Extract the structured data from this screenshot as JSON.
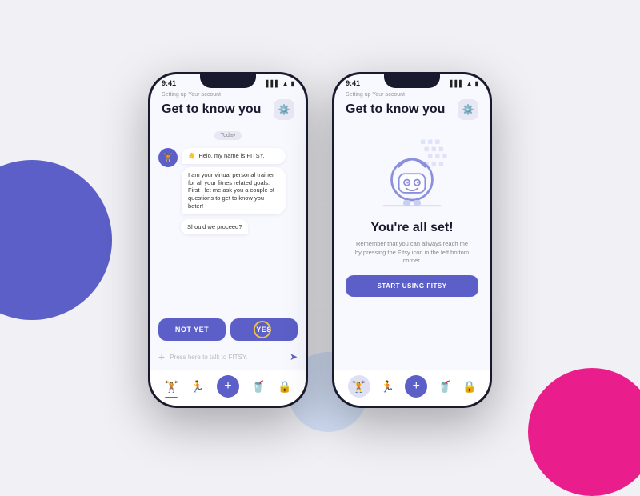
{
  "background": {
    "blob_blue_color": "#5b5fc7",
    "blob_pink_color": "#e91e8c"
  },
  "phone1": {
    "status_time": "9:41",
    "setting_label": "Setting up Your account",
    "page_title": "Get to know you",
    "date_badge": "Today",
    "bot_greeting_emoji": "👋",
    "bot_greeting_text": "Helo, my name is FITSY.",
    "bot_message": "I am your virtual personal trainer for all your fitnes related goals. First , let me ask you a couple of questions to get to know you beter!",
    "user_message": "Should we proceed?",
    "btn_not_yet": "NOT YET",
    "btn_yes": "YES",
    "input_placeholder": "Press here to talk to FITSY.",
    "nav_items": [
      "🏋️",
      "🏃",
      "+",
      "🥤",
      "🔒"
    ]
  },
  "phone2": {
    "status_time": "9:41",
    "setting_label": "Setting up Your account",
    "page_title": "Get to know you",
    "success_title": "You're all set!",
    "success_desc": "Remember that you can allways reach me by pressing the Fitsy icon in the left bottom corner.",
    "start_btn": "START USING FITSY",
    "nav_items": [
      "🏋️",
      "🏃",
      "+",
      "🥤",
      "🔒"
    ]
  }
}
